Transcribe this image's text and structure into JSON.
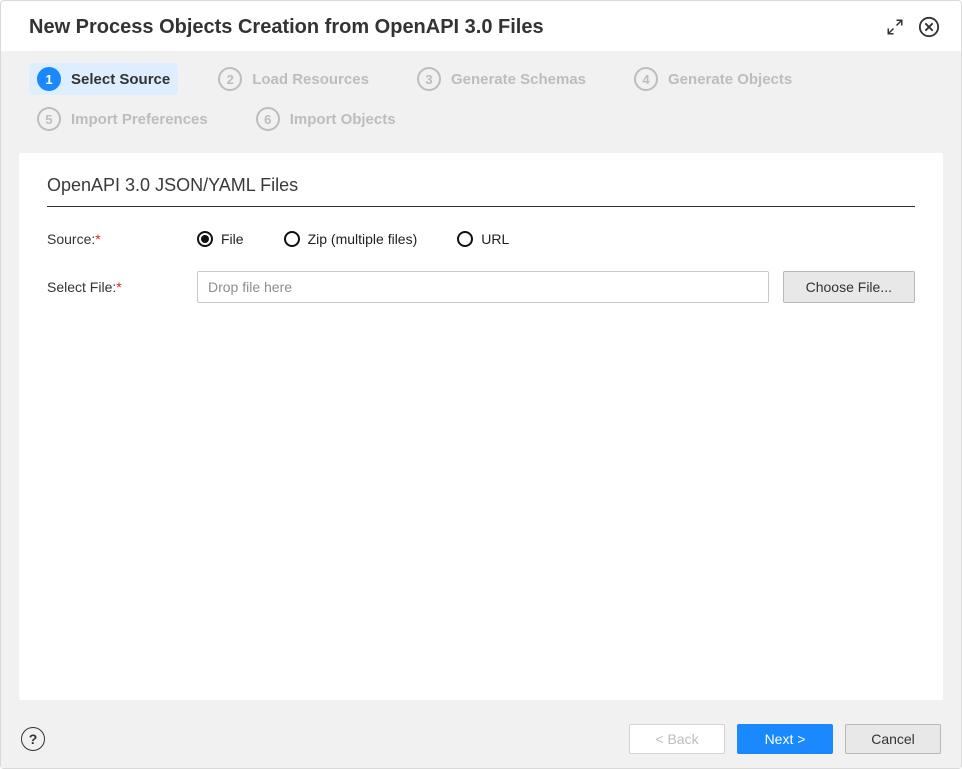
{
  "header": {
    "title": "New Process Objects Creation from OpenAPI 3.0 Files"
  },
  "steps": [
    {
      "num": "1",
      "label": "Select Source",
      "active": true
    },
    {
      "num": "2",
      "label": "Load Resources",
      "active": false
    },
    {
      "num": "3",
      "label": "Generate Schemas",
      "active": false
    },
    {
      "num": "4",
      "label": "Generate Objects",
      "active": false
    },
    {
      "num": "5",
      "label": "Import Preferences",
      "active": false
    },
    {
      "num": "6",
      "label": "Import Objects",
      "active": false
    }
  ],
  "section": {
    "title": "OpenAPI 3.0 JSON/YAML Files"
  },
  "form": {
    "source_label": "Source:",
    "source_options": {
      "file": "File",
      "zip": "Zip (multiple files)",
      "url": "URL"
    },
    "source_selected": "file",
    "select_file_label": "Select File:",
    "drop_placeholder": "Drop file here",
    "choose_file_label": "Choose File..."
  },
  "footer": {
    "help": "?",
    "back": "< Back",
    "next": "Next >",
    "cancel": "Cancel"
  }
}
